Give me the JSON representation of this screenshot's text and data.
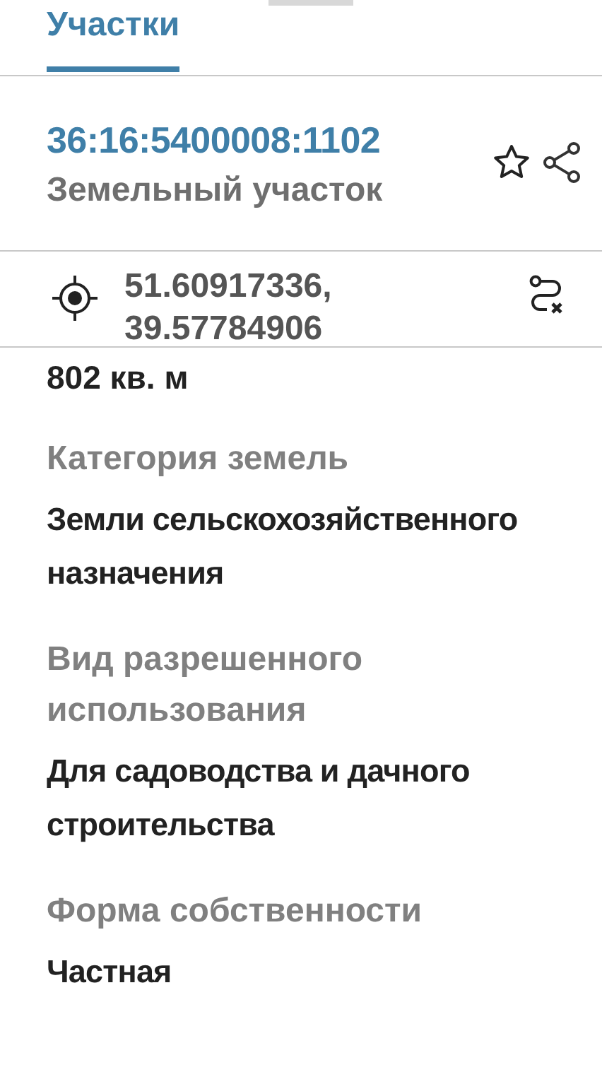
{
  "tabs": [
    {
      "label": "Участки",
      "selected": true
    }
  ],
  "parcel": {
    "cadastral_number": "36:16:5400008:1102",
    "type": "Земельный участок",
    "favorite": false
  },
  "coordinates": "51.60917336, 39.57784906",
  "area": "802 кв. м",
  "properties": [
    {
      "label": "Категория земель",
      "value": "Земли сельскохозяйственного назначения"
    },
    {
      "label": "Вид разрешенного использования",
      "value": "Для садоводства и дачного строительства"
    },
    {
      "label": "Форма собственности",
      "value": "Частная"
    }
  ]
}
